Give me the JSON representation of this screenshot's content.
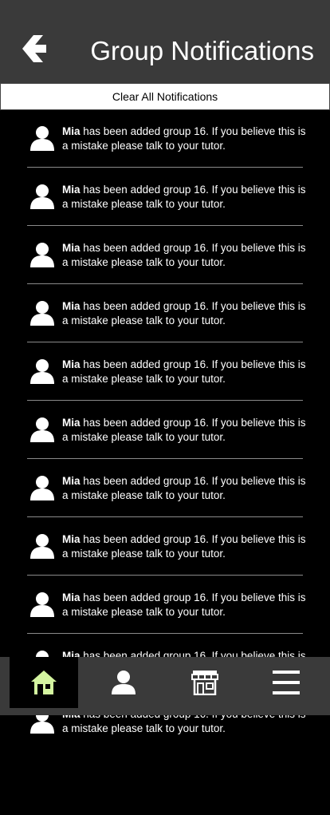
{
  "header": {
    "title": "Group Notifications",
    "back_icon": "back-arrow-icon"
  },
  "clear_button": {
    "label": "Clear All Notifications"
  },
  "notifications": [
    {
      "name": "Mia",
      "message": " has been added group 16. If you believe this is a mistake please talk to your tutor."
    },
    {
      "name": "Mia",
      "message": " has been added group 16. If you believe this is a mistake please talk to your tutor."
    },
    {
      "name": "Mia",
      "message": " has been added group 16. If you believe this is a mistake please talk to your tutor."
    },
    {
      "name": "Mia",
      "message": " has been added group 16. If you believe this is a mistake please talk to your tutor."
    },
    {
      "name": "Mia",
      "message": " has been added group 16. If you believe this is a mistake please talk to your tutor."
    },
    {
      "name": "Mia",
      "message": " has been added group 16. If you believe this is a mistake please talk to your tutor."
    },
    {
      "name": "Mia",
      "message": " has been added group 16. If you believe this is a mistake please talk to your tutor."
    },
    {
      "name": "Mia",
      "message": " has been added group 16. If you believe this is a mistake please talk to your tutor."
    },
    {
      "name": "Mia",
      "message": " has been added group 16. If you believe this is a mistake please talk to your tutor."
    },
    {
      "name": "Mia",
      "message": " has been added group 16. If you believe this is a mistake please talk to your tutor."
    },
    {
      "name": "Mia",
      "message": " has been added group 16. If you believe this is a mistake please talk to your tutor."
    }
  ],
  "bottom_nav": {
    "items": [
      {
        "icon": "home-icon",
        "active": true
      },
      {
        "icon": "profile-icon",
        "active": false
      },
      {
        "icon": "store-icon",
        "active": false
      },
      {
        "icon": "menu-icon",
        "active": false
      }
    ]
  },
  "colors": {
    "background": "#000000",
    "header": "#3a3a3a",
    "active_icon": "#d4f5a0",
    "text": "#ffffff"
  }
}
